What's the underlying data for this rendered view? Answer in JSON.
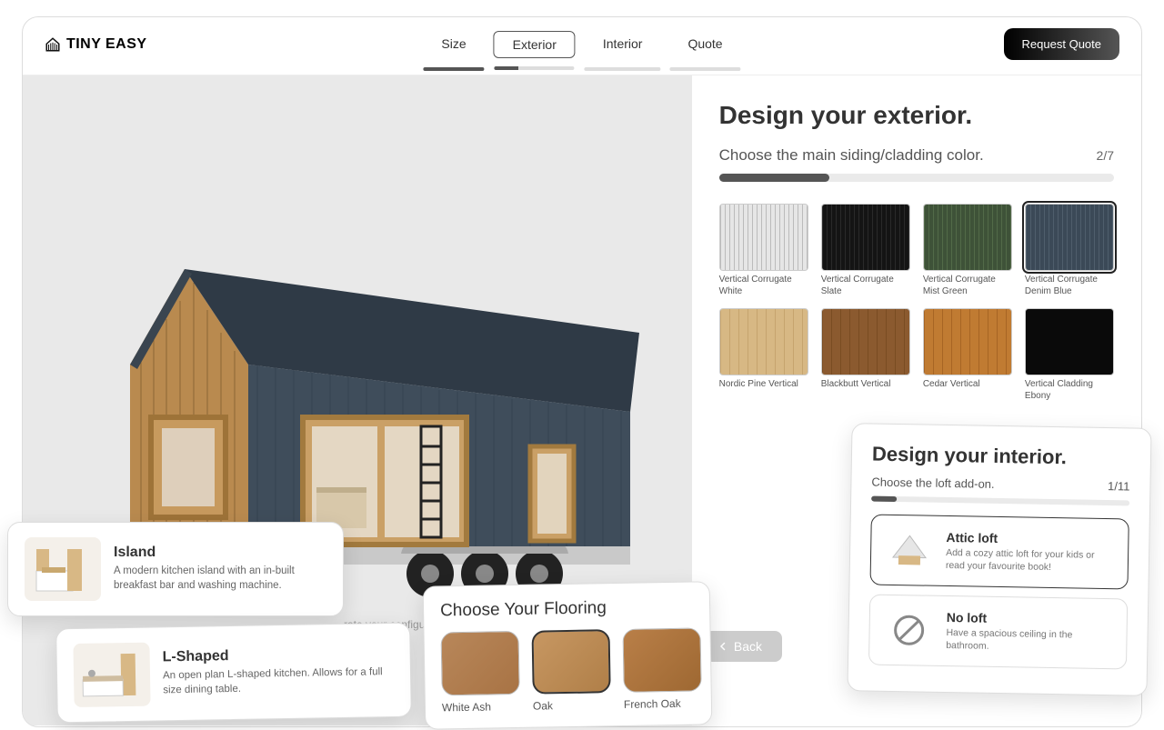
{
  "logo_text": "TINY EASY",
  "nav": {
    "size": "Size",
    "exterior": "Exterior",
    "interior": "Interior",
    "quote": "Quote"
  },
  "request_quote": "Request Quote",
  "exterior_panel": {
    "title": "Design your exterior.",
    "subtitle": "Choose the main siding/cladding color.",
    "step": "2/7",
    "swatches": [
      {
        "label": "Vertical Corrugate White"
      },
      {
        "label": "Vertical Corrugate Slate"
      },
      {
        "label": "Vertical Corrugate Mist Green"
      },
      {
        "label": "Vertical Corrugate Denim Blue"
      },
      {
        "label": "Nordic Pine Vertical"
      },
      {
        "label": "Blackbutt Vertical"
      },
      {
        "label": "Cedar Vertical"
      },
      {
        "label": "Vertical Cladding Ebony"
      }
    ]
  },
  "back_label": "Back",
  "kitchen_island": {
    "title": "Island",
    "desc": "A modern kitchen island with an in-built breakfast bar and washing machine."
  },
  "kitchen_lshape": {
    "title": "L-Shaped",
    "desc": "An open plan L-shaped kitchen. Allows for a full size dining table."
  },
  "configure_fragment": "rate your configu",
  "flooring": {
    "title": "Choose Your Flooring",
    "options": [
      "White Ash",
      "Oak",
      "French Oak"
    ]
  },
  "interior_panel": {
    "title": "Design your interior.",
    "subtitle": "Choose the loft add-on.",
    "step": "1/11",
    "attic": {
      "title": "Attic loft",
      "desc": "Add a cozy attic loft for your kids or read your favourite book!"
    },
    "noloft": {
      "title": "No loft",
      "desc": "Have a spacious ceiling in the bathroom."
    }
  }
}
